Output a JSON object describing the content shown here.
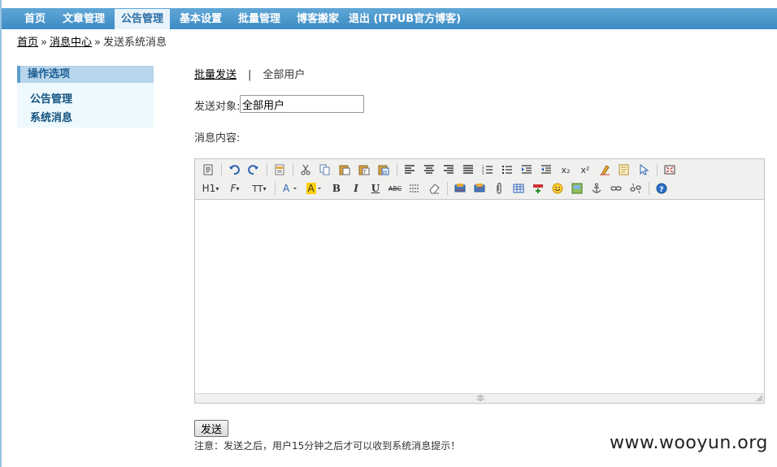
{
  "nav": {
    "items": [
      {
        "label": "首页"
      },
      {
        "label": "文章管理"
      },
      {
        "label": "公告管理"
      },
      {
        "label": "基本设置"
      },
      {
        "label": "批量管理"
      },
      {
        "label": "博客搬家"
      },
      {
        "label": "退出 (ITPUB官方博客)"
      }
    ],
    "active": "公告管理"
  },
  "breadcrumb": {
    "home": "首页",
    "sep1": "»",
    "message_center": "消息中心",
    "sep2": "»",
    "current": "发送系统消息"
  },
  "sidebar": {
    "title": "操作选项",
    "items": [
      {
        "label": "公告管理"
      },
      {
        "label": "系统消息"
      }
    ]
  },
  "main": {
    "tabs": {
      "batch_send": "批量发送",
      "separator": "|",
      "all_users": "全部用户"
    },
    "target_label": "发送对象:",
    "target_value": "全部用户",
    "content_label": "消息内容:",
    "send_button": "发送",
    "notice": "注意：发送之后，用户15分钟之后才可以收到系统消息提示！"
  },
  "editor": {
    "row1_icons": [
      "source-icon",
      "undo-icon",
      "redo-icon",
      "preview-icon",
      "cut-icon",
      "copy-icon",
      "paste-icon",
      "paste-text-icon",
      "paste-word-icon",
      "align-left-icon",
      "align-center-icon",
      "align-right-icon",
      "align-justify-icon",
      "ordered-list-icon",
      "unordered-list-icon",
      "indent-icon",
      "outdent-icon",
      "subscript-icon",
      "superscript-icon",
      "clear-format-icon",
      "select-all-icon",
      "pointer-icon",
      "fullscreen-icon"
    ],
    "row2_icons": [
      "heading-icon",
      "font-family-icon",
      "font-size-icon",
      "font-color-icon",
      "highlight-icon",
      "bold-icon",
      "italic-icon",
      "underline-icon",
      "strikethrough-icon",
      "horizontal-rule-icon",
      "eraser-icon",
      "insert-image-icon",
      "insert-flash-icon",
      "attachment-icon",
      "table-icon",
      "insert-row-icon",
      "emoticon-icon",
      "image-icon",
      "anchor-icon",
      "link-icon",
      "unlink-icon",
      "help-icon"
    ],
    "heading_label": "H1",
    "font_label": "F",
    "fontsize_label": "TT",
    "sub_label": "x₂",
    "sup_label": "x²",
    "bold_label": "B",
    "italic_label": "I",
    "underline_label": "U",
    "strike_label": "ABC"
  },
  "watermark": "www.wooyun.org",
  "colors": {
    "nav_bg": "#3c8bc4",
    "nav_active_bg": "#e8f2fa",
    "sidebar_title_bg": "#b7d5eb",
    "sidebar_bg": "#eef9fd",
    "editor_toolbar_bg": "#f0f0ee"
  }
}
